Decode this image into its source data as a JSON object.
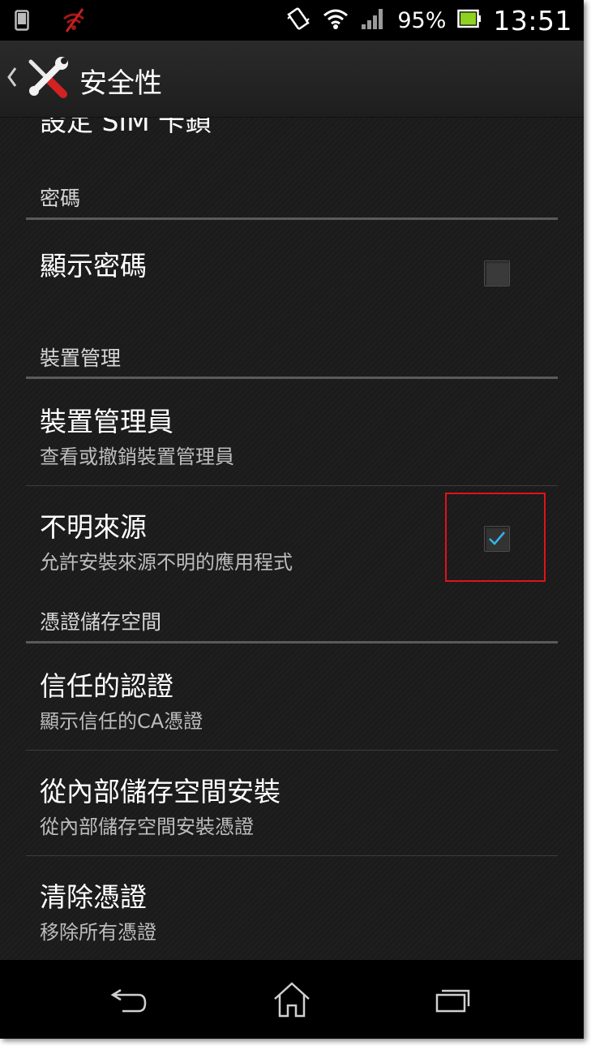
{
  "status_bar": {
    "battery_percent": "95%",
    "time": "13:51",
    "icons": [
      "phone-icon",
      "wifi-off-icon",
      "vibrate-icon",
      "wifi-icon",
      "signal-icon",
      "battery-icon"
    ]
  },
  "action_bar": {
    "title": "安全性",
    "app_icon": "tools-icon"
  },
  "top_partial_item": "設定 SIM 卡鎖",
  "sections": {
    "password": {
      "header": "密碼",
      "items": [
        {
          "title": "顯示密碼",
          "checked": false
        }
      ]
    },
    "device_admin": {
      "header": "裝置管理",
      "items": [
        {
          "title": "裝置管理員",
          "subtitle": "查看或撤銷裝置管理員"
        },
        {
          "title": "不明來源",
          "subtitle": "允許安裝來源不明的應用程式",
          "checked": true
        }
      ]
    },
    "credential_storage": {
      "header": "憑證儲存空間",
      "items": [
        {
          "title": "信任的認證",
          "subtitle": "顯示信任的CA憑證"
        },
        {
          "title": "從內部儲存空間安裝",
          "subtitle": "從內部儲存空間安裝憑證"
        },
        {
          "title": "清除憑證",
          "subtitle": "移除所有憑證"
        }
      ]
    }
  },
  "nav_bar": {
    "buttons": [
      "back-icon",
      "home-icon",
      "recent-apps-icon"
    ]
  },
  "colors": {
    "background": "#1b1b1b",
    "checkmark": "#33b5e5",
    "highlight": "#e0121a"
  }
}
